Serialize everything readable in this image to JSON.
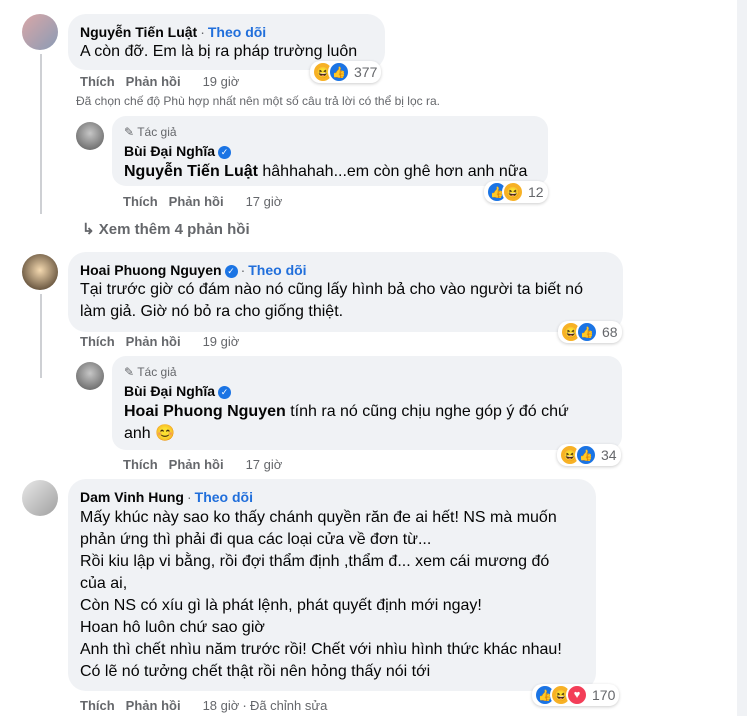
{
  "comments": [
    {
      "author": "Nguyễn Tiến Luật",
      "follow": "Theo dõi",
      "text": "A còn đỡ. Em là bị ra pháp trường luôn",
      "like": "Thích",
      "reply": "Phản hồi",
      "time": "19 giờ",
      "reactions": "377"
    },
    {
      "author": "Hoai Phuong Nguyen",
      "follow": "Theo dõi",
      "text_line1": "Tại trước giờ có đám nào nó cũng lấy hình bả cho vào người ta biết nó",
      "text_line2": "làm giả. Giờ nó bỏ ra cho giống thiệt.",
      "like": "Thích",
      "reply": "Phản hồi",
      "time": "19 giờ",
      "reactions": "68"
    },
    {
      "author": "Dam Vinh Hung",
      "follow": "Theo dõi",
      "lines": [
        "Mấy khúc này sao ko thấy chánh quyền răn đe ai hết! NS mà muốn",
        "phản ứng thì phải đi qua các loại cửa về đơn từ...",
        "Rồi kiu lập vi bằng, rồi đợi thẩm định ,thẩm đ... xem cái mương đó",
        "của ai,",
        "Còn NS có xíu gì là phát lệnh, phát quyết định mới ngay!",
        "Hoan hô luôn chứ sao giờ",
        "Anh thì chết nhìu năm trước rồi! Chết với nhìu hình thức khác nhau!",
        "Có lẽ nó tưởng chết thật rồi nên hỏng thấy nói tới"
      ],
      "like": "Thích",
      "reply": "Phản hồi",
      "time": "18 giờ",
      "edited": "Đã chỉnh sửa",
      "reactions": "170"
    }
  ],
  "replies": [
    {
      "badge": "Tác giả",
      "author": "Bùi Đại Nghĩa",
      "tag": "Nguyễn Tiến Luật",
      "text": " hâhhahah...em còn ghê hơn anh nữa",
      "like": "Thích",
      "reply": "Phản hồi",
      "time": "17 giờ",
      "reactions": "12"
    },
    {
      "badge": "Tác giả",
      "author": "Bùi Đại Nghĩa",
      "tag": "Hoai Phuong Nguyen",
      "text": " tính ra nó cũng chịu nghe góp ý đó chứ",
      "text2": "anh 😊",
      "like": "Thích",
      "reply": "Phản hồi",
      "time": "17 giờ",
      "reactions": "34"
    }
  ],
  "filter_notice": "Đã chọn chế độ Phù hợp nhất nên một số câu trả lời có thể bị lọc ra.",
  "more_replies": "Xem thêm 4 phản hồi",
  "icons": {
    "like": "like-icon",
    "haha": "haha-icon",
    "love": "love-icon",
    "pencil": "pencil-icon",
    "reply_arrow": "reply-arrow-icon",
    "verified": "verified-icon"
  },
  "colors": {
    "follow": "#216fdb",
    "bubble": "#f0f2f5",
    "like": "#1b74e4"
  }
}
